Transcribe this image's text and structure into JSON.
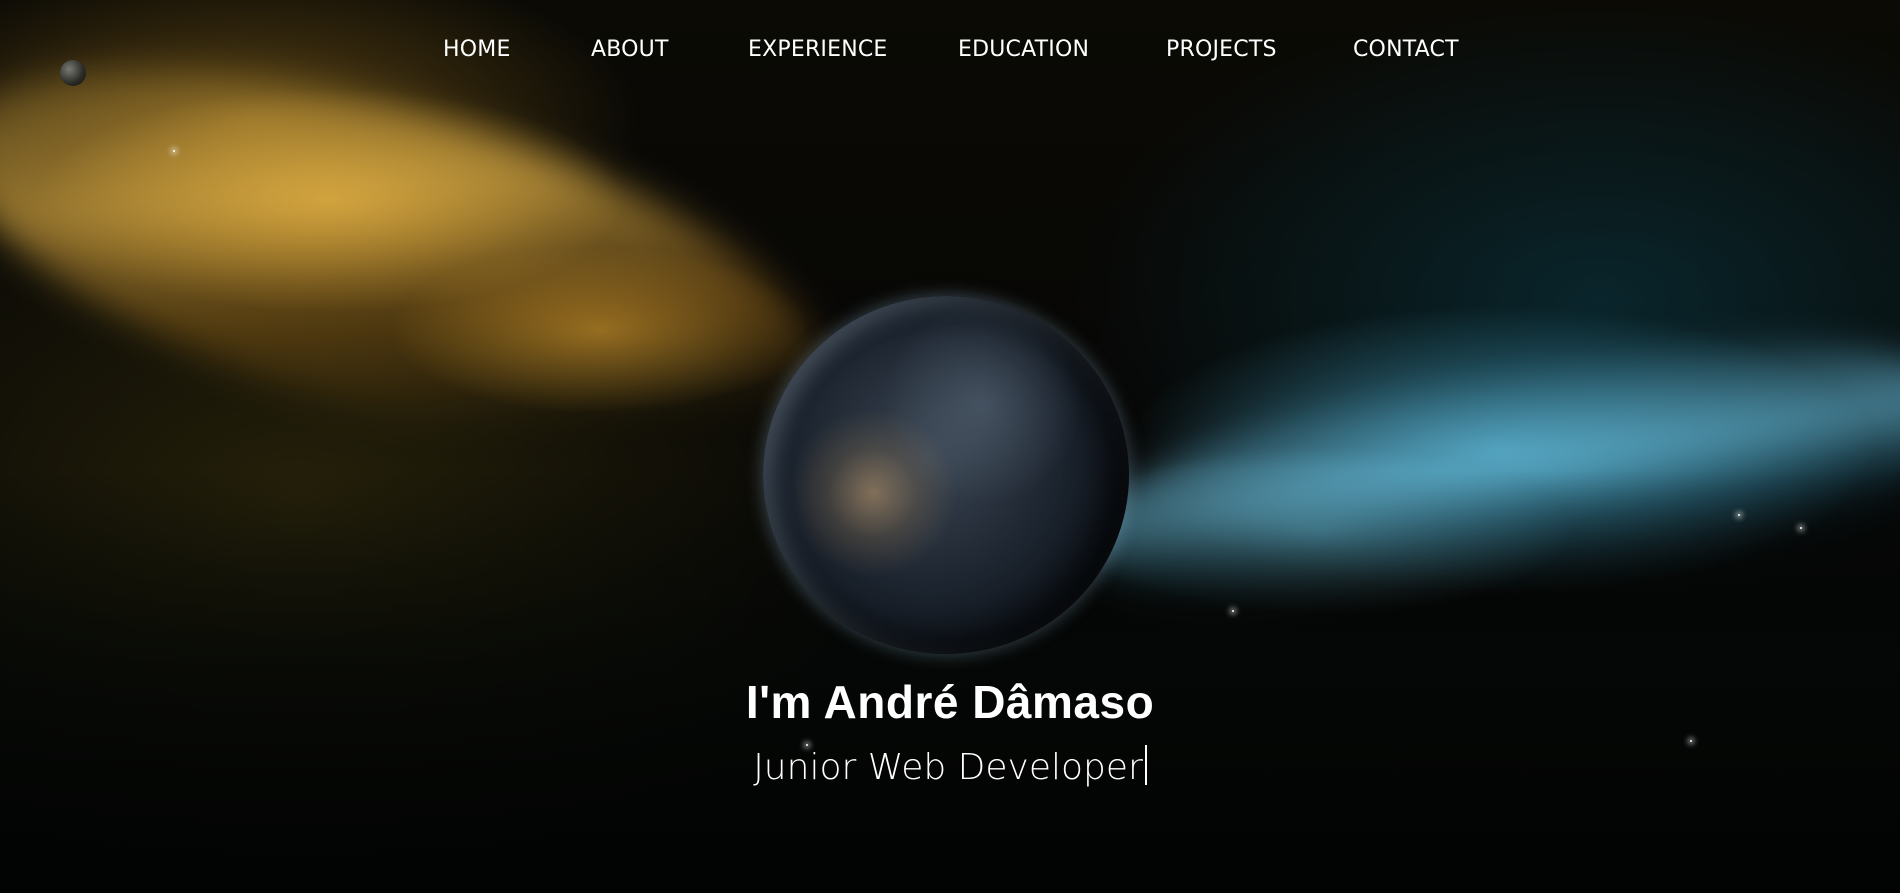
{
  "nav": {
    "items": [
      {
        "label": "HOME"
      },
      {
        "label": "ABOUT"
      },
      {
        "label": "EXPERIENCE"
      },
      {
        "label": "EDUCATION"
      },
      {
        "label": "PROJECTS"
      },
      {
        "label": "CONTACT"
      }
    ]
  },
  "hero": {
    "title": "I'm André Dâmaso",
    "subtitle": "Junior Web Developer"
  },
  "colors": {
    "text": "#ffffff",
    "background": "#000000",
    "nebula_gold": "#ffc850",
    "nebula_blue": "#78dcff"
  }
}
